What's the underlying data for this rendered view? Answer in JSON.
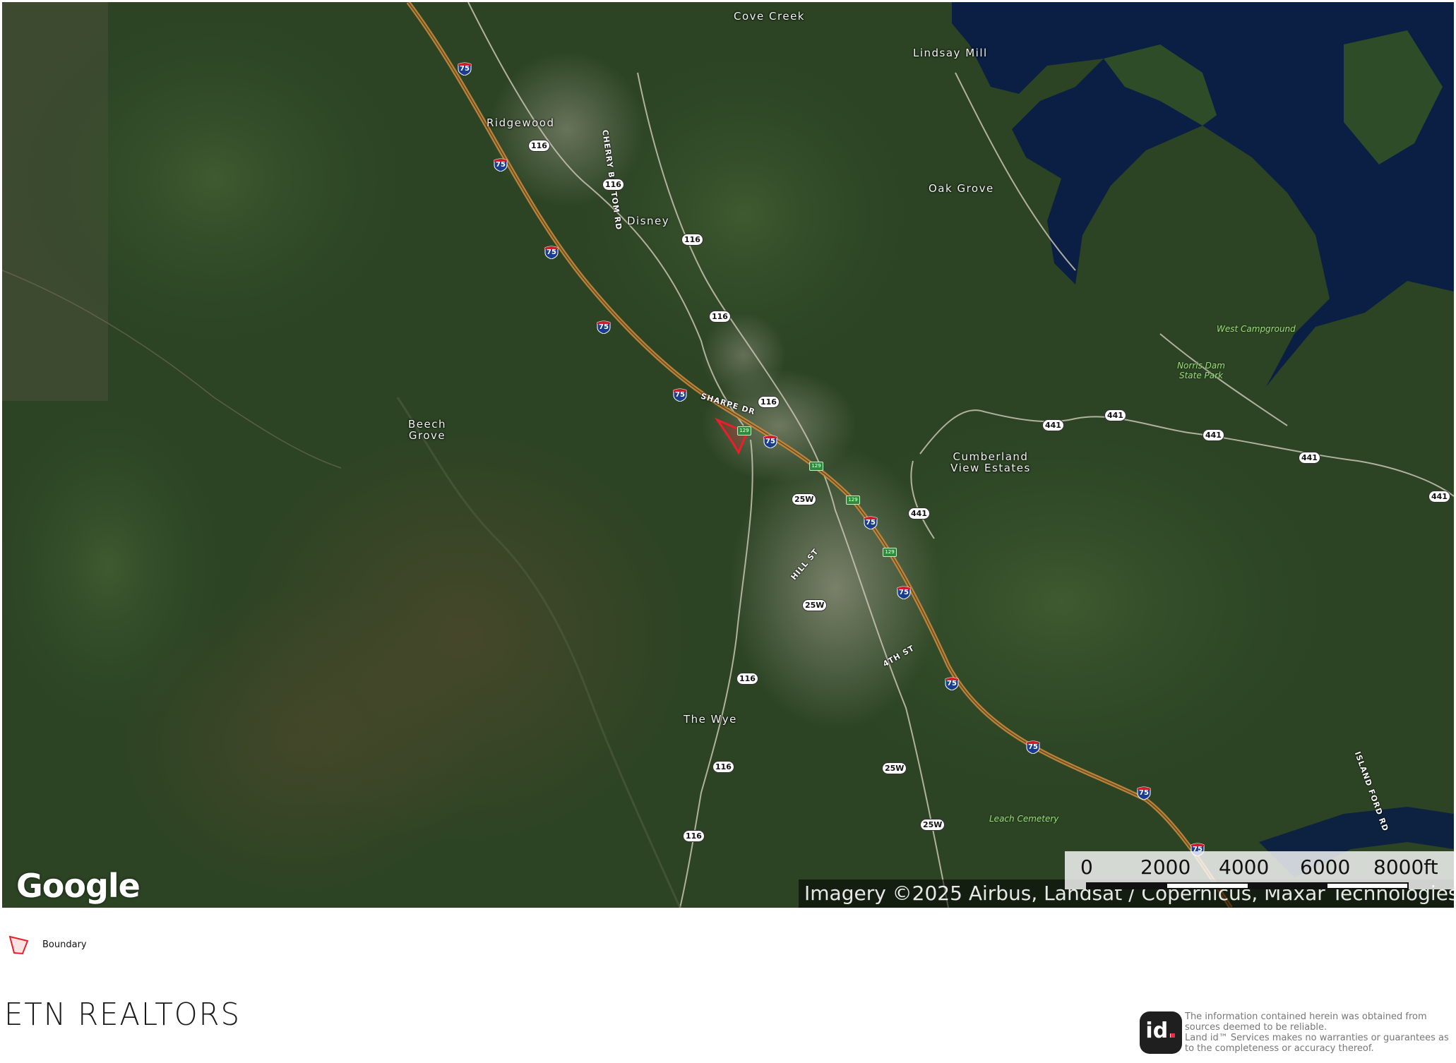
{
  "map": {
    "provider_logo": "Google",
    "attribution": "Imagery ©2025 Airbus, Landsat / Copernicus, Maxar Technologies",
    "places": [
      "Cove Creek",
      "Lindsay Mill",
      "Ridgewood",
      "Disney",
      "Oak Grove",
      "Beech Grove",
      "Cumberland View Estates",
      "The Wye"
    ],
    "roads": [
      "CHERRY BOTTOM RD",
      "SHARPE DR",
      "HILL ST",
      "4TH ST",
      "ISLAND FORD RD"
    ],
    "parks": [
      "West Campground",
      "Norris Dam State Park",
      "Leach Cemetery"
    ],
    "interstate_shield": "75",
    "us_route_shields": [
      "116",
      "441",
      "25W"
    ],
    "state_route_shield": "129",
    "colors": {
      "boundary": "#e8202a",
      "lake": "#0b1f44",
      "forest": "#2d4526",
      "interstate": "#c98a3c"
    }
  },
  "scale_bar": {
    "ticks": [
      "0",
      "2000",
      "4000",
      "6000",
      "8000ft"
    ]
  },
  "legend": {
    "items": [
      {
        "icon": "boundary-polygon-icon",
        "label": "Boundary"
      }
    ]
  },
  "footer": {
    "brand": "ETN REALTORS",
    "id_logo": "id.",
    "disclaimer": "The information contained herein was obtained from sources deemed to be reliable.\n  Land id™ Services makes no warranties or guarantees as to the completeness or accuracy thereof."
  }
}
